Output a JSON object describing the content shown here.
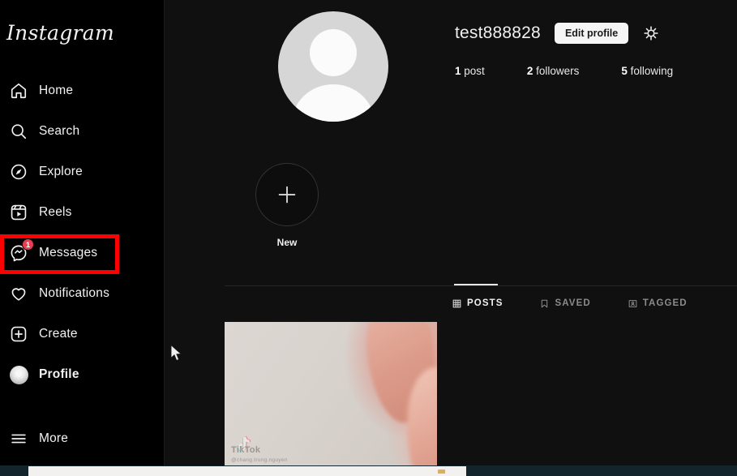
{
  "app": {
    "brand": "Instagram"
  },
  "sidebar": {
    "items": [
      {
        "label": "Home",
        "icon": "home-icon",
        "active": false,
        "badge": null
      },
      {
        "label": "Search",
        "icon": "search-icon",
        "active": false,
        "badge": null
      },
      {
        "label": "Explore",
        "icon": "compass-icon",
        "active": false,
        "badge": null
      },
      {
        "label": "Reels",
        "icon": "reels-icon",
        "active": false,
        "badge": null
      },
      {
        "label": "Messages",
        "icon": "messenger-icon",
        "active": false,
        "badge": "1"
      },
      {
        "label": "Notifications",
        "icon": "heart-icon",
        "active": false,
        "badge": null
      },
      {
        "label": "Create",
        "icon": "plus-square-icon",
        "active": false,
        "badge": null
      },
      {
        "label": "Profile",
        "icon": "avatar-icon",
        "active": true,
        "badge": null
      },
      {
        "label": "More",
        "icon": "hamburger-icon",
        "active": false,
        "badge": null
      }
    ],
    "annotation": {
      "target": "Messages",
      "color": "#fe0000"
    }
  },
  "profile": {
    "username": "test888828",
    "edit_button": "Edit profile",
    "settings_icon": "gear-icon",
    "avatar_icon": "default-avatar-icon",
    "stats": [
      {
        "value": "1",
        "label": "post"
      },
      {
        "value": "2",
        "label": "followers"
      },
      {
        "value": "5",
        "label": "following"
      }
    ],
    "highlights": [
      {
        "label": "New",
        "icon": "plus-icon"
      }
    ]
  },
  "tabs": [
    {
      "label": "POSTS",
      "icon": "grid-icon",
      "active": true
    },
    {
      "label": "SAVED",
      "icon": "bookmark-icon",
      "active": false
    },
    {
      "label": "TAGGED",
      "icon": "tag-person-icon",
      "active": false
    }
  ],
  "posts": [
    {
      "watermark_name": "TikTok",
      "watermark_note": "@chang.trung.nguyen"
    }
  ],
  "colors": {
    "accent_red": "#ed3b4f",
    "annotation_red": "#fe0000",
    "sidebar_bg": "#000000",
    "main_bg": "#101010",
    "text_primary": "#f2f2f2",
    "text_secondary": "#8b8b8b"
  }
}
